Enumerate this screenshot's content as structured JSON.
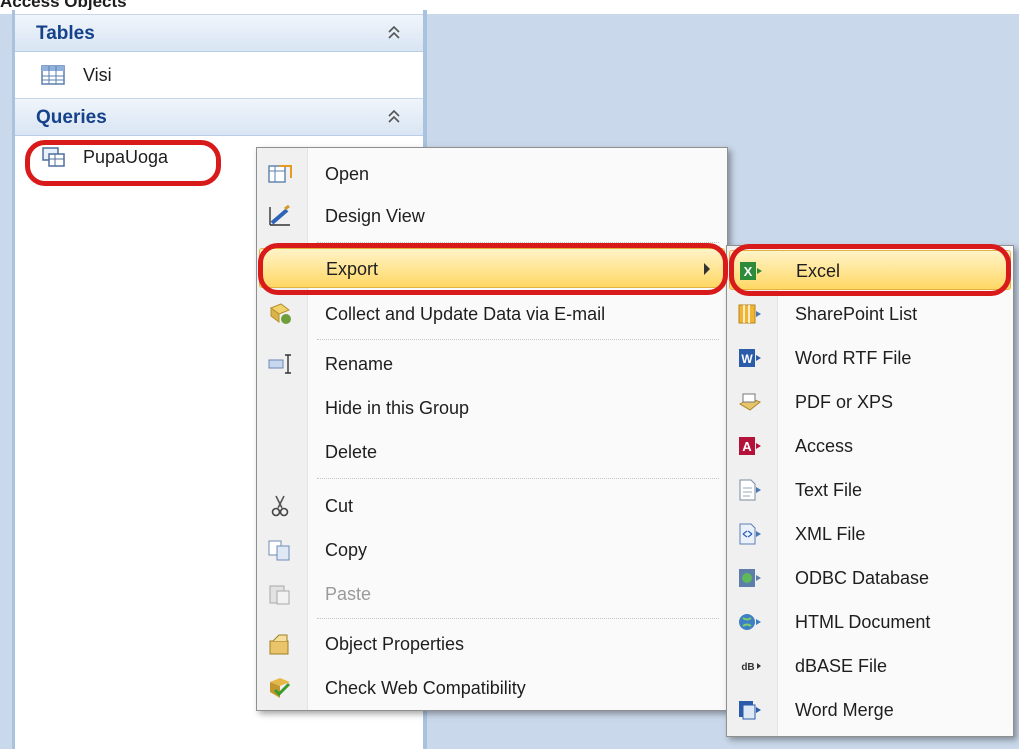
{
  "top_strip": {
    "text": "Access Objects"
  },
  "nav_pane": {
    "groups": [
      {
        "label": "Tables",
        "items": [
          {
            "label": "Visi"
          }
        ]
      },
      {
        "label": "Queries",
        "items": [
          {
            "label": "PupaUoga"
          }
        ]
      }
    ]
  },
  "context_menu": {
    "items": [
      {
        "label": "Open",
        "icon": "open-icon"
      },
      {
        "label": "Design View",
        "icon": "design-view-icon"
      },
      {
        "label": "Export",
        "icon": "",
        "highlighted": true,
        "submenu": true
      },
      {
        "label": "Collect and Update Data via E-mail",
        "icon": "collect-data-icon"
      },
      {
        "label": "Rename",
        "icon": "rename-icon"
      },
      {
        "label": "Hide in this Group",
        "icon": ""
      },
      {
        "label": "Delete",
        "icon": ""
      },
      {
        "label": "Cut",
        "icon": "scissors-icon"
      },
      {
        "label": "Copy",
        "icon": "copy-icon"
      },
      {
        "label": "Paste",
        "icon": "paste-icon",
        "disabled": true
      },
      {
        "label": "Object Properties",
        "icon": "properties-icon"
      },
      {
        "label": "Check Web Compatibility",
        "icon": "web-check-icon"
      }
    ]
  },
  "export_submenu": {
    "items": [
      {
        "label": "Excel",
        "icon": "excel-icon",
        "highlighted": true
      },
      {
        "label": "SharePoint List",
        "icon": "sharepoint-icon"
      },
      {
        "label": "Word RTF File",
        "icon": "word-icon"
      },
      {
        "label": "PDF or XPS",
        "icon": "pdf-icon"
      },
      {
        "label": "Access",
        "icon": "access-icon"
      },
      {
        "label": "Text File",
        "icon": "text-file-icon"
      },
      {
        "label": "XML File",
        "icon": "xml-icon"
      },
      {
        "label": "ODBC Database",
        "icon": "odbc-icon"
      },
      {
        "label": "HTML Document",
        "icon": "html-icon"
      },
      {
        "label": "dBASE File",
        "icon": "dbase-icon"
      },
      {
        "label": "Word Merge",
        "icon": "word-merge-icon"
      }
    ]
  },
  "colors": {
    "highlight_ring": "#d91a1a",
    "group_header_text": "#15428b",
    "menu_highlight": "#ffd764"
  }
}
